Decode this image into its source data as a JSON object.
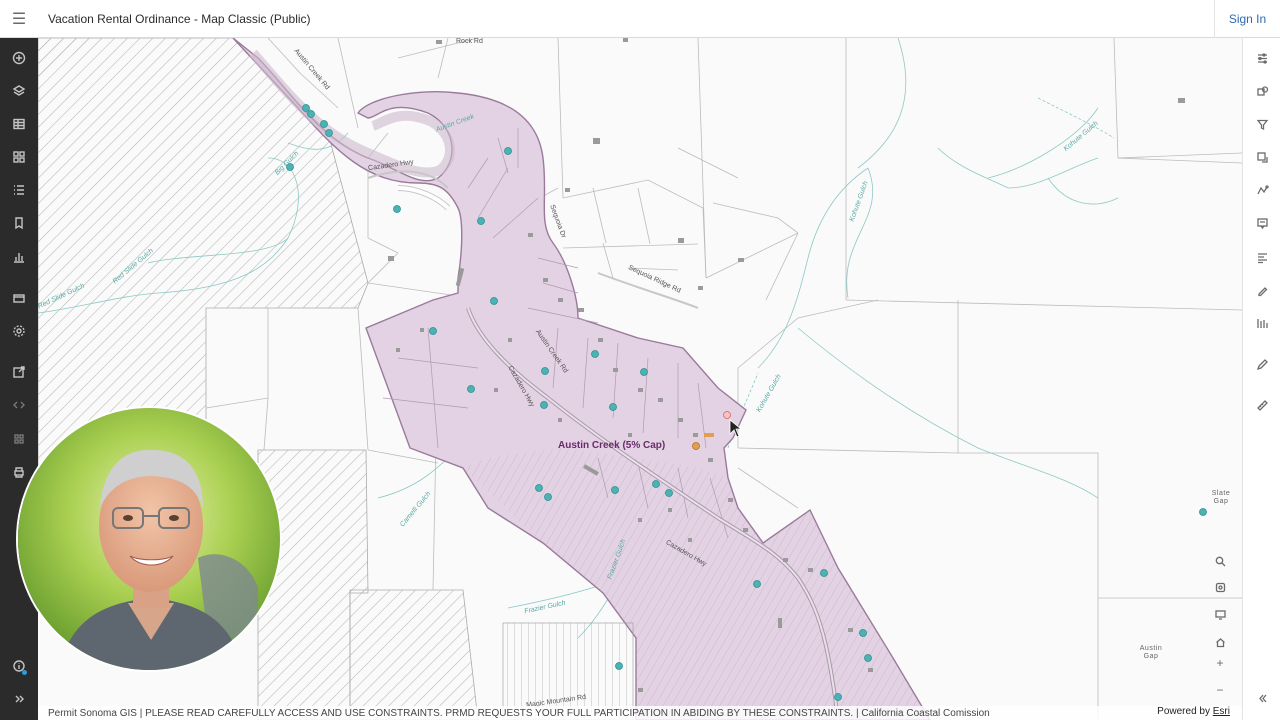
{
  "header": {
    "menu_icon": "hamburger-icon",
    "title": "Vacation Rental Ordinance - Map Classic (Public)",
    "signin": "Sign In"
  },
  "left_toolbar": [
    {
      "icon": "add-icon"
    },
    {
      "icon": "layers-icon"
    },
    {
      "icon": "table-icon"
    },
    {
      "icon": "basemap-gallery-icon"
    },
    {
      "icon": "legend-icon"
    },
    {
      "icon": "bookmark-icon"
    },
    {
      "icon": "chart-icon"
    },
    {
      "icon": "folder-icon"
    },
    {
      "icon": "gear-icon"
    },
    {
      "icon": "share-icon"
    },
    {
      "icon": "embed-icon"
    },
    {
      "icon": "apps-icon"
    },
    {
      "icon": "print-icon"
    },
    {
      "icon": "info-icon"
    },
    {
      "icon": "expand-icon"
    }
  ],
  "right_toolbar": [
    {
      "icon": "properties-icon"
    },
    {
      "icon": "styles-icon"
    },
    {
      "icon": "filter-icon"
    },
    {
      "icon": "effects-icon"
    },
    {
      "icon": "pop-ups-icon"
    },
    {
      "icon": "configure-popup-icon"
    },
    {
      "icon": "labels-icon"
    },
    {
      "icon": "sketch-icon"
    },
    {
      "icon": "analysis-icon"
    },
    {
      "icon": "edit-icon"
    },
    {
      "icon": "measure-icon"
    },
    {
      "icon": "collapse-icon"
    }
  ],
  "map": {
    "zone_label": "Austin Creek (5% Cap)",
    "zone_fill": "#e3d2e3",
    "zone_stroke": "#9a7a9a",
    "point_color": "#4bb3b3",
    "water_labels": [
      {
        "text": "Austin Creek"
      },
      {
        "text": "Big Gulch"
      },
      {
        "text": "Red Slide Gulch"
      },
      {
        "text": "Kohute Gulch"
      },
      {
        "text": "Kohute Gulch"
      },
      {
        "text": "Camelli Gulch"
      },
      {
        "text": "Frazier Gulch"
      },
      {
        "text": "Frazier Gulch"
      },
      {
        "text": "Kohute Gulch"
      },
      {
        "text": "Red Slide Gulch"
      }
    ],
    "road_labels": [
      {
        "text": "Cazadero Hwy"
      },
      {
        "text": "Cazadero Hwy"
      },
      {
        "text": "Cazadero Hwy"
      },
      {
        "text": "Austin Creek Rd"
      },
      {
        "text": "Sequoia Ridge Rd"
      },
      {
        "text": "Magic Mountain Rd"
      },
      {
        "text": "Rock Rd"
      },
      {
        "text": "Austin Creek Rd"
      },
      {
        "text": "Sequoia Dr"
      }
    ],
    "place_labels": [
      {
        "text": "Slate Gap"
      },
      {
        "text": "Austin Gap"
      }
    ]
  },
  "map_nav": [
    {
      "icon": "search-icon"
    },
    {
      "icon": "locate-icon"
    },
    {
      "icon": "fullscreen-icon"
    },
    {
      "icon": "home-icon"
    },
    {
      "label": "+"
    },
    {
      "label": "−"
    }
  ],
  "attribution": {
    "text": "Permit Sonoma GIS | PLEASE READ CAREFULLY ACCESS AND USE CONSTRAINTS. PRMD REQUESTS YOUR FULL PARTICIPATION IN ABIDING BY THESE CONSTRAINTS. | California Coastal Comission",
    "powered_prefix": "Powered by ",
    "powered_brand": "Esri"
  }
}
